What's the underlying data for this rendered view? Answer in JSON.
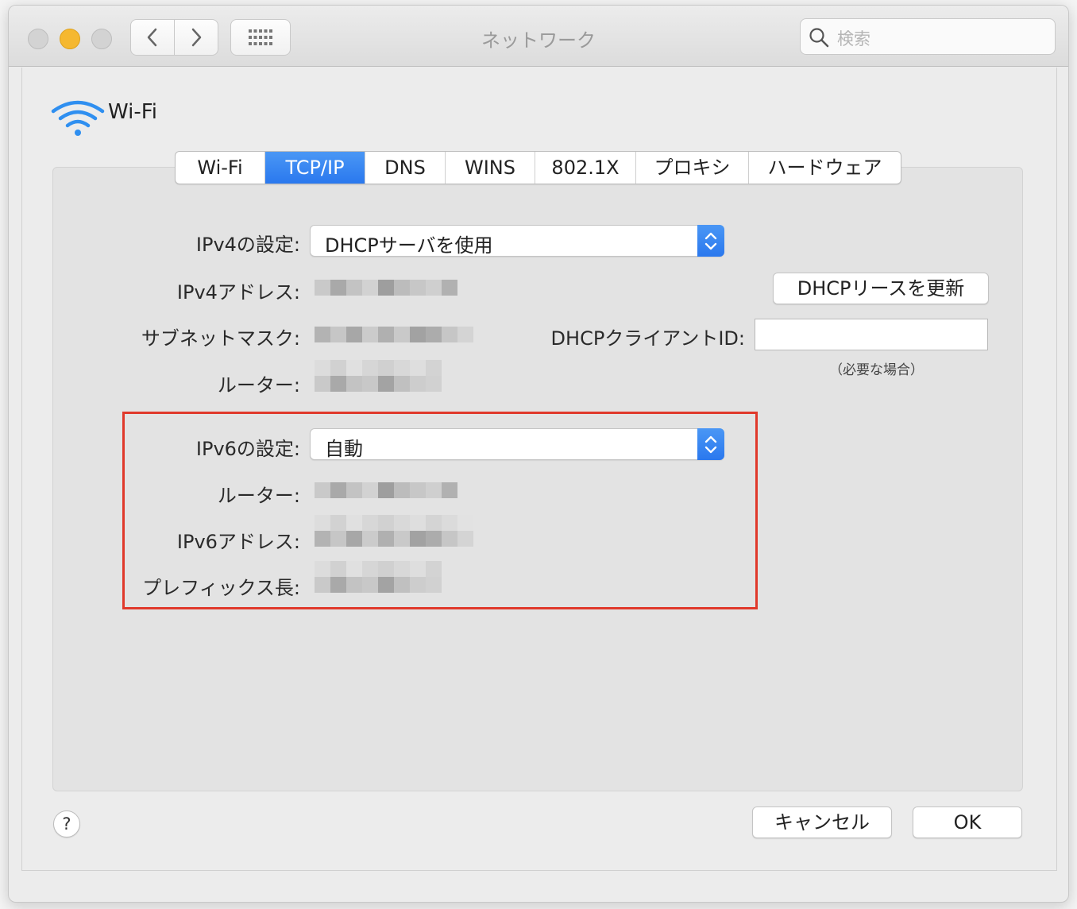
{
  "window": {
    "title": "ネットワーク",
    "search_placeholder": "検索",
    "traffic_lights": [
      "#cfcfcf",
      "#f5b830",
      "#cfcfcf"
    ]
  },
  "header": {
    "service_name": "Wi-Fi",
    "icon": "wifi-icon",
    "icon_color": "#2f8ff0"
  },
  "tabs": [
    {
      "label": "Wi-Fi",
      "active": false
    },
    {
      "label": "TCP/IP",
      "active": true
    },
    {
      "label": "DNS",
      "active": false
    },
    {
      "label": "WINS",
      "active": false
    },
    {
      "label": "802.1X",
      "active": false
    },
    {
      "label": "プロキシ",
      "active": false
    },
    {
      "label": "ハードウェア",
      "active": false
    }
  ],
  "ipv4": {
    "config_label": "IPv4の設定:",
    "config_value": "DHCPサーバを使用",
    "address_label": "IPv4アドレス:",
    "subnet_label": "サブネットマスク:",
    "router_label": "ルーター:",
    "renew_button": "DHCPリースを更新",
    "client_id_label": "DHCPクライアントID:",
    "client_id_value": "",
    "client_id_hint": "（必要な場合）"
  },
  "ipv6": {
    "config_label": "IPv6の設定:",
    "config_value": "自動",
    "router_label": "ルーター:",
    "address_label": "IPv6アドレス:",
    "prefix_label": "プレフィックス長:"
  },
  "footer": {
    "help_label": "?",
    "cancel_button": "キャンセル",
    "ok_button": "OK"
  },
  "colors": {
    "accent": "#2a78ee",
    "highlight_box": "#e0392b"
  }
}
